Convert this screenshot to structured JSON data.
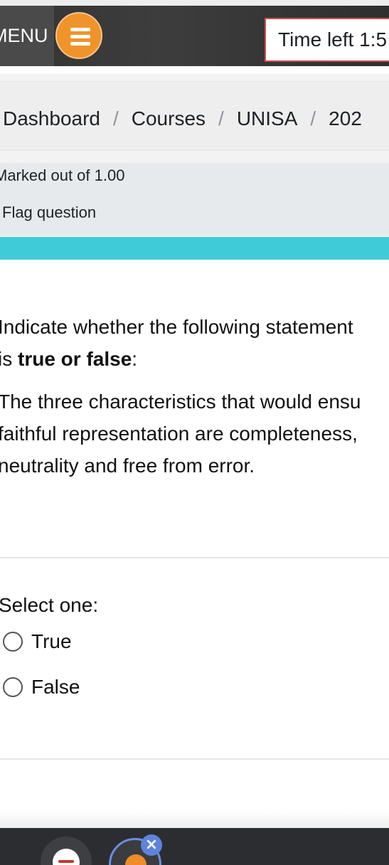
{
  "header": {
    "menu_label": "MENU",
    "timer_text": "Time left 1:5"
  },
  "breadcrumb": {
    "items": [
      "Dashboard",
      "Courses",
      "UNISA",
      "202"
    ],
    "separator": "/"
  },
  "question_info": {
    "marked_text": "Marked out of 1.00",
    "flag_label": "Flag question"
  },
  "question": {
    "line1": "Indicate whether the following statement",
    "line2_prefix": "is ",
    "line2_bold": "true or false",
    "line2_suffix": ":",
    "statement_lines": [
      "The three characteristics that would ensu",
      "faithful representation are completeness,",
      "neutrality and free from error."
    ]
  },
  "answer": {
    "select_label": "Select one:",
    "options": [
      "True",
      "False"
    ]
  },
  "colors": {
    "menu_button": "#f0932b",
    "timer_border": "#c94c4c",
    "accent_bar": "#40cbd9",
    "topbar": "#333333"
  },
  "icons": {
    "menu": "hamburger-icon",
    "bubble1": "chat-head-icon",
    "bubble2": "moodle-app-icon",
    "close": "close-icon"
  }
}
